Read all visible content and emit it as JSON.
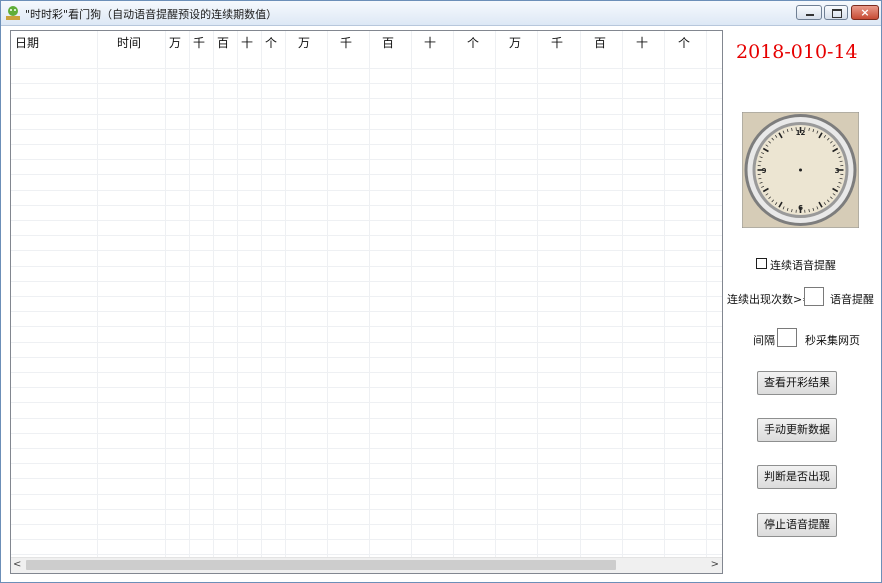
{
  "window": {
    "title": "\"时时彩\"看门狗（自动语音提醒预设的连续期数值）",
    "icon": "green-alien-app-icon",
    "controls": {
      "minimize": "minimize-icon",
      "maximize": "maximize-icon",
      "close": "×"
    }
  },
  "grid": {
    "columns": [
      "日期",
      "时间",
      "万",
      "千",
      "百",
      "十",
      "个",
      "万",
      "千",
      "百",
      "十",
      "个",
      "万",
      "千",
      "百",
      "十",
      "个"
    ],
    "rows": [],
    "scroll": {
      "left": "<",
      "right": ">"
    }
  },
  "date_display": "2018-010-14",
  "clock": {
    "n12": "12",
    "n3": "3",
    "n6": "6",
    "n9": "9"
  },
  "controls": {
    "voice_checkbox_label": "连续语音提醒",
    "consecutive_label": "连续出现次数>=",
    "consecutive_value": "",
    "voice_label": "语音提醒",
    "interval_label": "间隔",
    "interval_value": "",
    "interval_unit": "秒采集网页",
    "btn_view_results": "查看开彩结果",
    "btn_manual_update": "手动更新数据",
    "btn_check": "判断是否出现",
    "btn_stop_voice": "停止语音提醒"
  },
  "colors": {
    "date": "#e60000",
    "title_bar": "#dde8f5",
    "close_button": "#c64a34",
    "clock_face": "#ece5d2"
  }
}
